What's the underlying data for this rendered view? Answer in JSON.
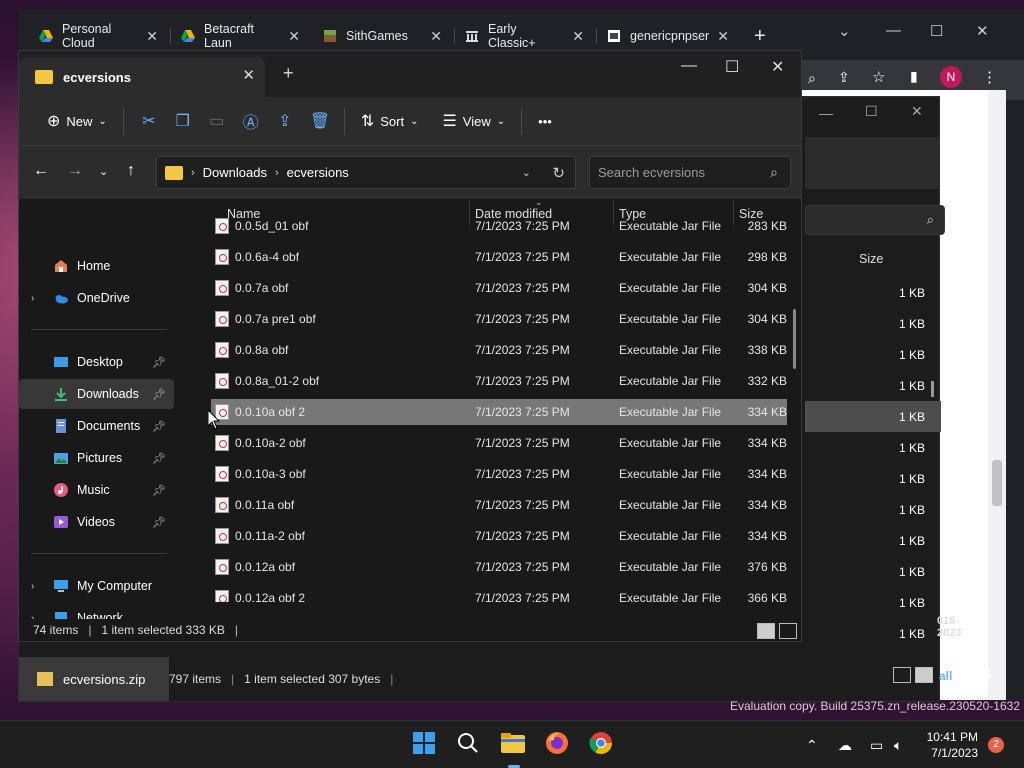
{
  "browser": {
    "tabs": [
      {
        "label": "Personal Cloud",
        "icon": "google-drive-icon"
      },
      {
        "label": "Betacraft Laun",
        "icon": "google-drive-icon"
      },
      {
        "label": "SithGames",
        "icon": "minecraft-icon"
      },
      {
        "label": "Early Classic+",
        "icon": "wiki-icon"
      },
      {
        "label": "genericpnpser",
        "icon": "page-icon"
      }
    ],
    "new_tab": "+",
    "profile_initial": "N"
  },
  "explorer_back": {
    "size_header": "Size",
    "sizes": [
      "1 KB",
      "1 KB",
      "1 KB",
      "1 KB",
      "1 KB",
      "1 KB",
      "1 KB",
      "1 KB",
      "1 KB",
      "1 KB",
      "1 KB",
      "1 KB"
    ],
    "selected_index": 4,
    "date_fragment": "018-2023",
    "file_tab": "ecversions.zip",
    "status_items": "797 items",
    "status_selected": "1 item selected  307 bytes",
    "extra_label": "all"
  },
  "explorer": {
    "tab_title": "ecversions",
    "toolbar": {
      "new_label": "New",
      "sort_label": "Sort",
      "view_label": "View",
      "more_label": "•••"
    },
    "breadcrumb": [
      "Downloads",
      "ecversions"
    ],
    "search_placeholder": "Search ecversions",
    "nav": {
      "home": "Home",
      "onedrive": "OneDrive",
      "desktop": "Desktop",
      "downloads": "Downloads",
      "documents": "Documents",
      "pictures": "Pictures",
      "music": "Music",
      "videos": "Videos",
      "mycomputer": "My Computer",
      "network": "Network"
    },
    "columns": {
      "name": "Name",
      "date": "Date modified",
      "type": "Type",
      "size": "Size"
    },
    "files": [
      {
        "name": "0.0.5d_01 obf",
        "date": "7/1/2023 7:25 PM",
        "type": "Executable Jar File",
        "size": "283 KB"
      },
      {
        "name": "0.0.6a-4 obf",
        "date": "7/1/2023 7:25 PM",
        "type": "Executable Jar File",
        "size": "298 KB"
      },
      {
        "name": "0.0.7a obf",
        "date": "7/1/2023 7:25 PM",
        "type": "Executable Jar File",
        "size": "304 KB"
      },
      {
        "name": "0.0.7a pre1 obf",
        "date": "7/1/2023 7:25 PM",
        "type": "Executable Jar File",
        "size": "304 KB"
      },
      {
        "name": "0.0.8a obf",
        "date": "7/1/2023 7:25 PM",
        "type": "Executable Jar File",
        "size": "338 KB"
      },
      {
        "name": "0.0.8a_01-2 obf",
        "date": "7/1/2023 7:25 PM",
        "type": "Executable Jar File",
        "size": "332 KB"
      },
      {
        "name": "0.0.10a obf 2",
        "date": "7/1/2023 7:25 PM",
        "type": "Executable Jar File",
        "size": "334 KB"
      },
      {
        "name": "0.0.10a-2 obf",
        "date": "7/1/2023 7:25 PM",
        "type": "Executable Jar File",
        "size": "334 KB"
      },
      {
        "name": "0.0.10a-3 obf",
        "date": "7/1/2023 7:25 PM",
        "type": "Executable Jar File",
        "size": "334 KB"
      },
      {
        "name": "0.0.11a obf",
        "date": "7/1/2023 7:25 PM",
        "type": "Executable Jar File",
        "size": "334 KB"
      },
      {
        "name": "0.0.11a-2 obf",
        "date": "7/1/2023 7:25 PM",
        "type": "Executable Jar File",
        "size": "334 KB"
      },
      {
        "name": "0.0.12a obf",
        "date": "7/1/2023 7:25 PM",
        "type": "Executable Jar File",
        "size": "376 KB"
      },
      {
        "name": "0.0.12a obf 2",
        "date": "7/1/2023 7:25 PM",
        "type": "Executable Jar File",
        "size": "366 KB"
      }
    ],
    "selected_index": 6,
    "status_items": "74 items",
    "status_selected": "1 item selected  333 KB"
  },
  "watermark": "Evaluation copy. Build 25375.zn_release.230520-1632",
  "taskbar": {
    "time": "10:41 PM",
    "date": "7/1/2023",
    "notifications": "2"
  }
}
